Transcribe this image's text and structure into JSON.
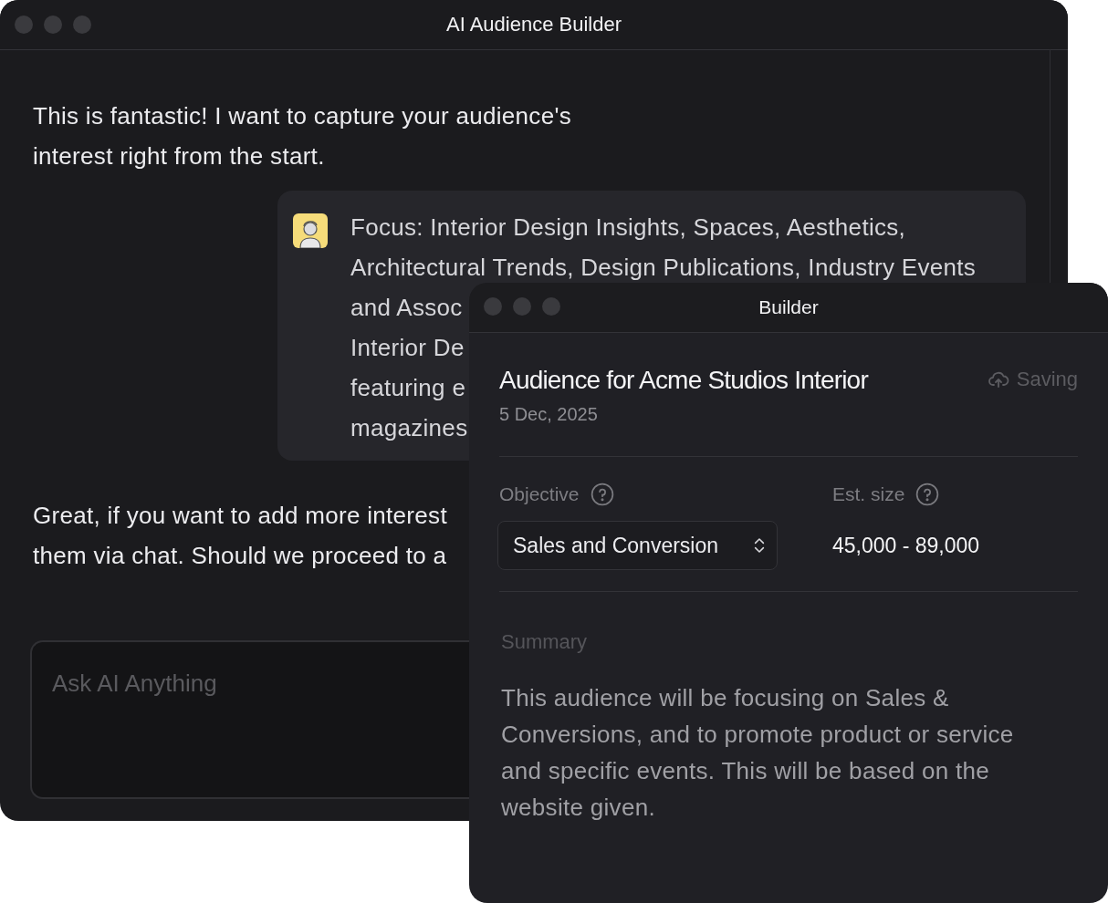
{
  "chat_window": {
    "title": "AI Audience Builder",
    "messages": [
      {
        "kind": "text",
        "lines": [
          "This is fantastic! I want to capture your audience's",
          "interest right from the start."
        ]
      },
      {
        "kind": "bubble",
        "lines": [
          "Focus: Interior Design Insights, Spaces, Aesthetics,",
          "Architectural Trends, Design Publications, Industry Events",
          "and Assoc",
          "Interior De",
          "featuring e",
          "magazines"
        ]
      },
      {
        "kind": "text",
        "lines": [
          "Great, if you want to add more interest",
          "them via chat. Should we proceed to a"
        ]
      }
    ],
    "input": {
      "placeholder": "Ask AI Anything"
    }
  },
  "builder_window": {
    "title": "Builder",
    "heading": "Audience for Acme Studios Interior",
    "date": "5 Dec, 2025",
    "status": "Saving",
    "objective": {
      "label": "Objective",
      "value": "Sales and Conversion"
    },
    "est_size": {
      "label": "Est. size",
      "value": "45,000 - 89,000"
    },
    "summary": {
      "label": "Summary",
      "text": "This audience will be focusing on Sales & Conversions, and to promote product or service and specific events. This will be based on the website given."
    }
  }
}
